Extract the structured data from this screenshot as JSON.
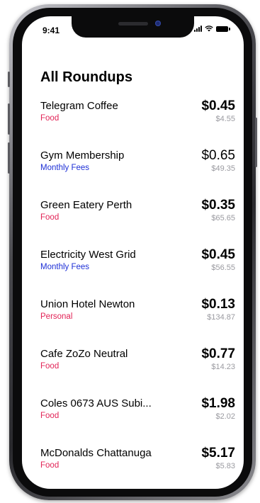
{
  "status_bar": {
    "time": "9:41"
  },
  "header": {
    "title": "All Roundups"
  },
  "roundups": [
    {
      "name": "Telegram Coffee",
      "category": "Food",
      "roundup": "$0.45",
      "total": "$4.55"
    },
    {
      "name": "Gym Membership",
      "category": "Monthly Fees",
      "roundup": "$0.65",
      "total": "$49.35"
    },
    {
      "name": "Green Eatery Perth",
      "category": "Food",
      "roundup": "$0.35",
      "total": "$65.65"
    },
    {
      "name": "Electricity West Grid",
      "category": "Monthly Fees",
      "roundup": "$0.45",
      "total": "$56.55"
    },
    {
      "name": "Union Hotel Newton",
      "category": "Personal",
      "roundup": "$0.13",
      "total": "$134.87"
    },
    {
      "name": "Cafe ZoZo Neutral",
      "category": "Food",
      "roundup": "$0.77",
      "total": "$14.23"
    },
    {
      "name": "Coles 0673 AUS Subi...",
      "category": "Food",
      "roundup": "$1.98",
      "total": "$2.02"
    },
    {
      "name": "McDonalds Chattanuga",
      "category": "Food",
      "roundup": "$5.17",
      "total": "$5.83"
    }
  ],
  "colors": {
    "food": "#e22356",
    "personal": "#e22356",
    "monthly_fees": "#1d2fd6",
    "secondary_text": "#9a9aa0"
  },
  "icons": [
    "signal-icon",
    "wifi-icon",
    "battery-icon"
  ]
}
